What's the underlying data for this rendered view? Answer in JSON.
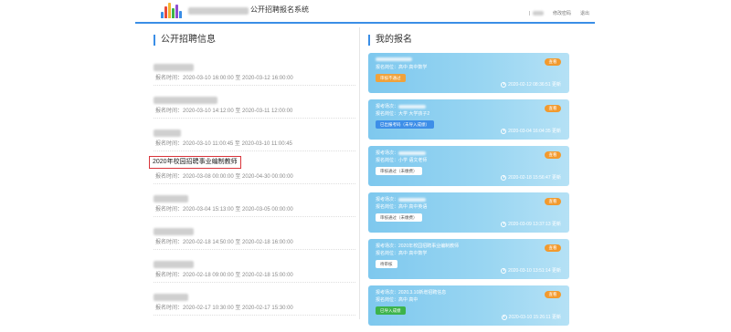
{
  "header": {
    "title": "公开招聘报名系统",
    "user_separator": "|",
    "change_password": "修改密码",
    "logout": "退出"
  },
  "left": {
    "title": "公开招聘信息",
    "notices": [
      {
        "title": "",
        "time": "报名时间：2020-03-10 16:00:00 至 2020-03-12 16:00:00"
      },
      {
        "title": "",
        "time": "报名时间：2020-03-10 14:12:00 至 2020-03-11 12:00:00"
      },
      {
        "title": "",
        "time": "报名时间：2020-03-10 11:00:45 至 2020-03-10 11:00:45"
      },
      {
        "title": "2020年校园招聘事业编制教师",
        "time": "报名时间：2020-03-08 00:00:00 至 2020-04-30 00:00:00"
      },
      {
        "title": "",
        "time": "报名时间：2020-03-04 15:13:00 至 2020-03-05 00:00:00"
      },
      {
        "title": "",
        "time": "报名时间：2020-02-18 14:50:00 至 2020-02-18 16:00:00"
      },
      {
        "title": "",
        "time": "报名时间：2020-02-18 09:00:00 至 2020-02-18 15:00:00"
      },
      {
        "title": "",
        "time": "报名时间：2020-02-17 10:30:00 至 2020-02-17 15:30:00"
      }
    ]
  },
  "right": {
    "title": "我的报名",
    "cards": [
      {
        "line1": "",
        "line2": "报名岗位：高中 高中数学",
        "status": "审核不通过",
        "status_color": "orange",
        "view": "查看",
        "updated": "2020-02-12 08:36:51 更新"
      },
      {
        "line1": "报考场次：",
        "line2": "报名岗位：大学 大学孩子2",
        "status": "已出报考码（未导入成绩）",
        "status_color": "blue",
        "view": "查看",
        "updated": "2020-03-04 16:04:35 更新"
      },
      {
        "line1": "报考场次：",
        "line2": "报名岗位：小学 语文老师",
        "status": "审核通过（未缴费）",
        "status_color": "white",
        "view": "查看",
        "updated": "2020-02-18 15:56:47 更新"
      },
      {
        "line1": "报考场次：",
        "line2": "报名岗位：高中 高中英语",
        "status": "审核通过（未缴费）",
        "status_color": "white",
        "view": "查看",
        "updated": "2020-03-09 13:37:13 更新"
      },
      {
        "line1": "报考场次：2020年校园招聘事业编制教师",
        "line2": "报名岗位：高中 高中数学",
        "status": "待审核",
        "status_color": "white",
        "view": "查看",
        "updated": "2020-03-10 13:51:14 更新"
      },
      {
        "line1": "报考场次：2020.3.10新增招聘信息",
        "line2": "报名岗位：高中 高中",
        "status": "已导入成绩",
        "status_color": "green",
        "view": "查看",
        "updated": "2020-03-10 15:26:11 更新"
      }
    ]
  },
  "colors": {
    "accent": "#3a8ee6",
    "card_blue": "#8fd0f0",
    "view_orange": "#f29a2e",
    "highlight_red": "#d9343b"
  }
}
